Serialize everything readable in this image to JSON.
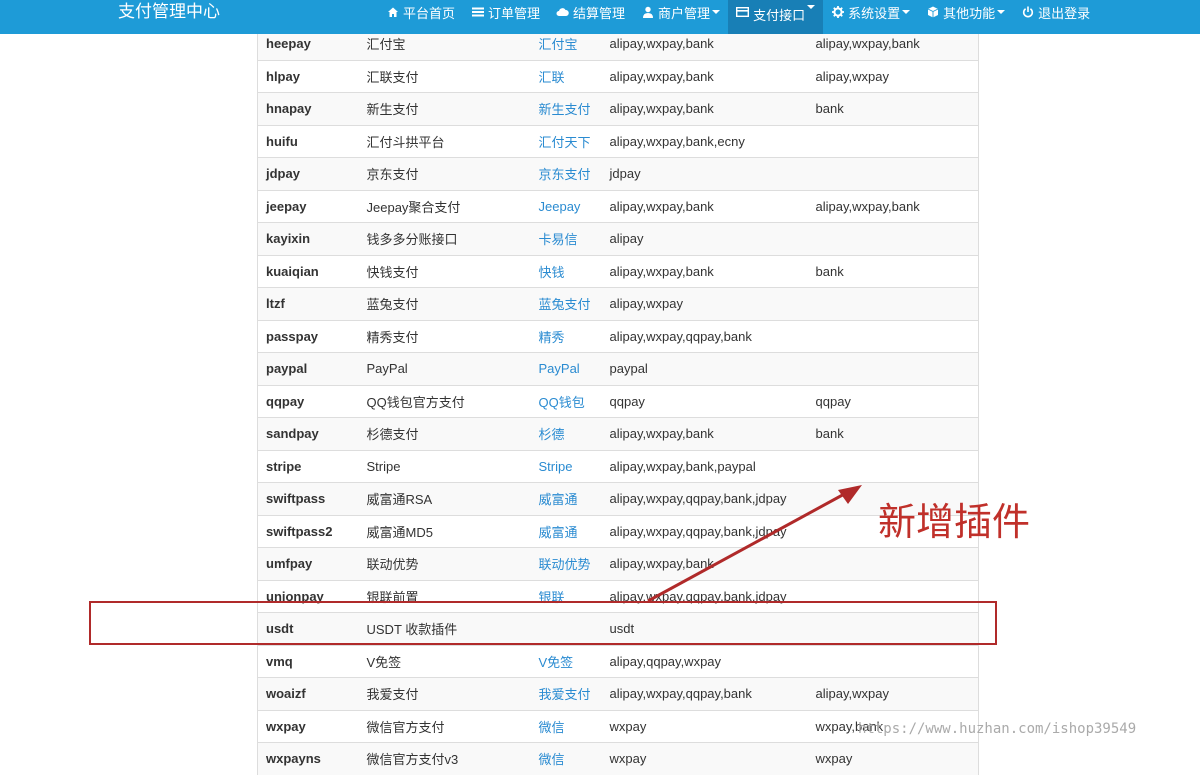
{
  "navbar": {
    "brand": "支付管理中心",
    "items": [
      {
        "icon": "home-icon",
        "label": "平台首页",
        "dropdown": false,
        "active": false
      },
      {
        "icon": "list-icon",
        "label": "订单管理",
        "dropdown": false,
        "active": false
      },
      {
        "icon": "cloud-icon",
        "label": "结算管理",
        "dropdown": false,
        "active": false
      },
      {
        "icon": "user-icon",
        "label": "商户管理",
        "dropdown": true,
        "active": false
      },
      {
        "icon": "card-icon",
        "label": "支付接口",
        "dropdown": true,
        "active": true
      },
      {
        "icon": "gear-icon",
        "label": "系统设置",
        "dropdown": true,
        "active": false
      },
      {
        "icon": "cube-icon",
        "label": "其他功能",
        "dropdown": true,
        "active": false
      },
      {
        "icon": "power-icon",
        "label": "退出登录",
        "dropdown": false,
        "active": false
      }
    ]
  },
  "plugins": [
    [
      "heepay",
      "汇付宝",
      "汇付宝",
      "alipay,wxpay,bank",
      "alipay,wxpay,bank"
    ],
    [
      "hlpay",
      "汇联支付",
      "汇联",
      "alipay,wxpay,bank",
      "alipay,wxpay"
    ],
    [
      "hnapay",
      "新生支付",
      "新生支付",
      "alipay,wxpay,bank",
      "bank"
    ],
    [
      "huifu",
      "汇付斗拱平台",
      "汇付天下",
      "alipay,wxpay,bank,ecny",
      ""
    ],
    [
      "jdpay",
      "京东支付",
      "京东支付",
      "jdpay",
      ""
    ],
    [
      "jeepay",
      "Jeepay聚合支付",
      "Jeepay",
      "alipay,wxpay,bank",
      "alipay,wxpay,bank"
    ],
    [
      "kayixin",
      "钱多多分账接口",
      "卡易信",
      "alipay",
      ""
    ],
    [
      "kuaiqian",
      "快钱支付",
      "快钱",
      "alipay,wxpay,bank",
      "bank"
    ],
    [
      "ltzf",
      "蓝兔支付",
      "蓝兔支付",
      "alipay,wxpay",
      ""
    ],
    [
      "passpay",
      "精秀支付",
      "精秀",
      "alipay,wxpay,qqpay,bank",
      ""
    ],
    [
      "paypal",
      "PayPal",
      "PayPal",
      "paypal",
      ""
    ],
    [
      "qqpay",
      "QQ钱包官方支付",
      "QQ钱包",
      "qqpay",
      "qqpay"
    ],
    [
      "sandpay",
      "杉德支付",
      "杉德",
      "alipay,wxpay,bank",
      "bank"
    ],
    [
      "stripe",
      "Stripe",
      "Stripe",
      "alipay,wxpay,bank,paypal",
      ""
    ],
    [
      "swiftpass",
      "威富通RSA",
      "威富通",
      "alipay,wxpay,qqpay,bank,jdpay",
      ""
    ],
    [
      "swiftpass2",
      "威富通MD5",
      "威富通",
      "alipay,wxpay,qqpay,bank,jdpay",
      ""
    ],
    [
      "umfpay",
      "联动优势",
      "联动优势",
      "alipay,wxpay,bank",
      ""
    ],
    [
      "unionpay",
      "银联前置",
      "银联",
      "alipay,wxpay,qqpay,bank,jdpay",
      ""
    ],
    [
      "usdt",
      "USDT 收款插件",
      "",
      "usdt",
      ""
    ],
    [
      "vmq",
      "V免签",
      "V免签",
      "alipay,qqpay,wxpay",
      ""
    ],
    [
      "woaizf",
      "我爱支付",
      "我爱支付",
      "alipay,wxpay,qqpay,bank",
      "alipay,wxpay"
    ],
    [
      "wxpay",
      "微信官方支付",
      "微信",
      "wxpay",
      "wxpay,bank"
    ],
    [
      "wxpayns",
      "微信官方支付v3",
      "微信",
      "wxpay",
      "wxpay"
    ]
  ],
  "annotation": {
    "text": "新增插件",
    "color": "#c0302a"
  },
  "watermark": "https://www.huzhan.com/ishop39549",
  "colors": {
    "navbar": "#1e9bd7",
    "nav_active": "#187fb6",
    "link": "#2a8bd1",
    "highlight": "#b02a2a"
  }
}
